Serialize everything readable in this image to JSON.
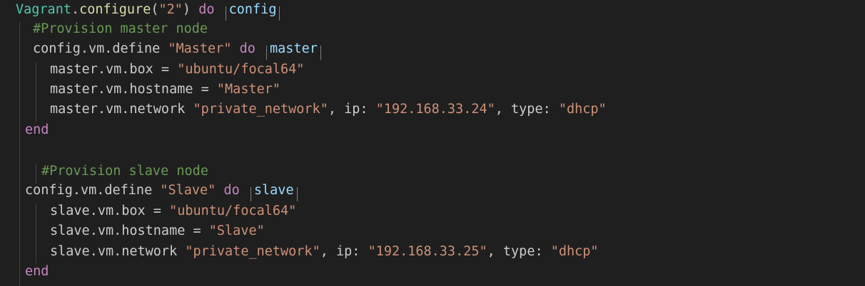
{
  "editor": {
    "language": "ruby",
    "colors": {
      "background": "#1f1f1f",
      "class": "#4ec9b0",
      "text": "#cccccc",
      "method": "#dcdcaa",
      "string": "#ce9178",
      "keyword": "#c586c0",
      "block_param": "#9cdcfe",
      "comment": "#6a9955",
      "indent_guide": "#404040"
    },
    "lines": [
      {
        "tokens": [
          {
            "t": "Vagrant",
            "c": "ident"
          },
          {
            "t": ".",
            "c": "plain"
          },
          {
            "t": "configure",
            "c": "func"
          },
          {
            "t": "(",
            "c": "plain"
          },
          {
            "t": "\"2\"",
            "c": "string"
          },
          {
            "t": ") ",
            "c": "plain"
          },
          {
            "t": "do",
            "c": "keyword"
          },
          {
            "t": " ",
            "c": "plain"
          },
          {
            "t": "|",
            "c": "symbol"
          },
          {
            "t": "config",
            "c": "param"
          },
          {
            "t": "|",
            "c": "symbol"
          }
        ]
      },
      {
        "tokens": [
          {
            "t": "#Provision master node",
            "c": "comment"
          }
        ]
      },
      {
        "tokens": [
          {
            "t": "config",
            "c": "plain"
          },
          {
            "t": ".",
            "c": "plain"
          },
          {
            "t": "vm",
            "c": "plain"
          },
          {
            "t": ".",
            "c": "plain"
          },
          {
            "t": "define",
            "c": "plain"
          },
          {
            "t": " ",
            "c": "plain"
          },
          {
            "t": "\"Master\"",
            "c": "string"
          },
          {
            "t": " ",
            "c": "plain"
          },
          {
            "t": "do",
            "c": "keyword"
          },
          {
            "t": " ",
            "c": "plain"
          },
          {
            "t": "|",
            "c": "symbol"
          },
          {
            "t": "master",
            "c": "param"
          },
          {
            "t": "|",
            "c": "symbol"
          }
        ]
      },
      {
        "tokens": [
          {
            "t": "master.vm.box = ",
            "c": "plain"
          },
          {
            "t": "\"ubuntu/focal64\"",
            "c": "string"
          }
        ]
      },
      {
        "tokens": [
          {
            "t": "master.vm.hostname = ",
            "c": "plain"
          },
          {
            "t": "\"Master\"",
            "c": "string"
          }
        ]
      },
      {
        "tokens": [
          {
            "t": "master.vm.network ",
            "c": "plain"
          },
          {
            "t": "\"private_network\"",
            "c": "string"
          },
          {
            "t": ", ip: ",
            "c": "plain"
          },
          {
            "t": "\"192.168.33.24\"",
            "c": "string"
          },
          {
            "t": ", type: ",
            "c": "plain"
          },
          {
            "t": "\"dhcp\"",
            "c": "string"
          }
        ]
      },
      {
        "tokens": [
          {
            "t": "end",
            "c": "keyword"
          }
        ]
      },
      {
        "tokens": []
      },
      {
        "tokens": [
          {
            "t": "#Provision slave node",
            "c": "comment"
          }
        ]
      },
      {
        "tokens": [
          {
            "t": "config.vm.define ",
            "c": "plain"
          },
          {
            "t": "\"Slave\"",
            "c": "string"
          },
          {
            "t": " ",
            "c": "plain"
          },
          {
            "t": "do",
            "c": "keyword"
          },
          {
            "t": " ",
            "c": "plain"
          },
          {
            "t": "|",
            "c": "symbol"
          },
          {
            "t": "slave",
            "c": "param"
          },
          {
            "t": "|",
            "c": "symbol"
          }
        ]
      },
      {
        "tokens": [
          {
            "t": "slave.vm.box = ",
            "c": "plain"
          },
          {
            "t": "\"ubuntu/focal64\"",
            "c": "string"
          }
        ]
      },
      {
        "tokens": [
          {
            "t": "slave.vm.hostname = ",
            "c": "plain"
          },
          {
            "t": "\"Slave\"",
            "c": "string"
          }
        ]
      },
      {
        "tokens": [
          {
            "t": "slave.vm.network ",
            "c": "plain"
          },
          {
            "t": "\"private_network\"",
            "c": "string"
          },
          {
            "t": ", ip: ",
            "c": "plain"
          },
          {
            "t": "\"192.168.33.25\"",
            "c": "string"
          },
          {
            "t": ", type: ",
            "c": "plain"
          },
          {
            "t": "\"dhcp\"",
            "c": "string"
          }
        ]
      },
      {
        "tokens": [
          {
            "t": "end",
            "c": "keyword"
          }
        ]
      }
    ]
  }
}
